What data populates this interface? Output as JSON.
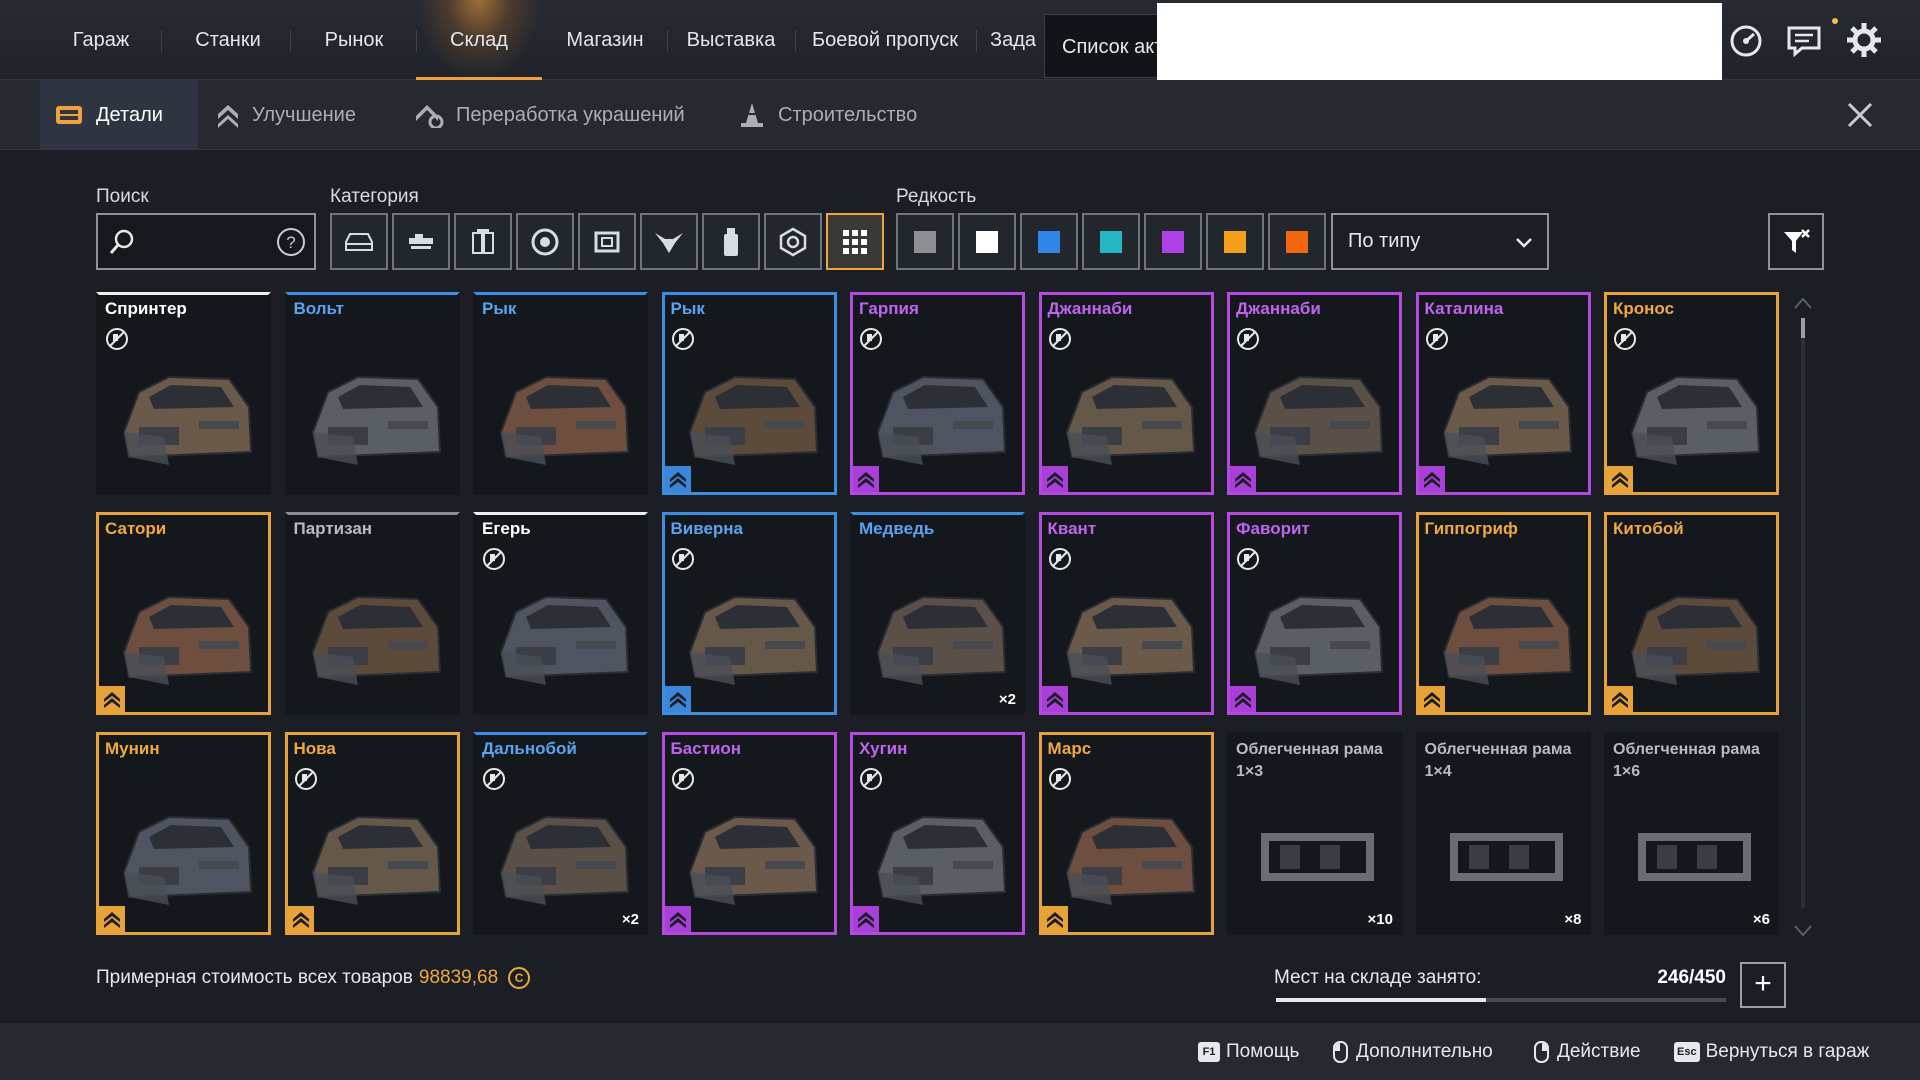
{
  "topnav": {
    "tabs": [
      {
        "label": "Гараж",
        "active": false
      },
      {
        "label": "Станки",
        "active": false
      },
      {
        "label": "Рынок",
        "active": false
      },
      {
        "label": "Склад",
        "active": true
      },
      {
        "label": "Магазин",
        "active": false
      },
      {
        "label": "Выставка",
        "active": false
      },
      {
        "label": "Боевой пропуск",
        "active": false
      },
      {
        "label": "Зада",
        "active": false
      }
    ],
    "tooltip": "Список акт",
    "icons": [
      "speedometer-icon",
      "chat-icon",
      "settings-icon"
    ]
  },
  "subnav": {
    "tabs": [
      {
        "label": "Детали",
        "icon": "parts-icon",
        "active": true
      },
      {
        "label": "Улучшение",
        "icon": "upgrade-icon",
        "active": false
      },
      {
        "label": "Переработка украшений",
        "icon": "recycle-icon",
        "active": false
      },
      {
        "label": "Строительство",
        "icon": "build-icon",
        "active": false
      }
    ],
    "close_icon": "close-icon"
  },
  "filters": {
    "search_label": "Поиск",
    "search_value": "",
    "category_label": "Категория",
    "categories": [
      "cabin-icon",
      "weapon-icon",
      "module-icon",
      "wheel-icon",
      "frame-icon",
      "drone-icon",
      "paint-icon",
      "decor-icon",
      "all-icon"
    ],
    "active_category": 8,
    "rarity_label": "Редкость",
    "rarities": [
      "#8d8f92",
      "#ffffff",
      "#2f86e8",
      "#25b8c4",
      "#b03fe8",
      "#f59f1e",
      "#f2660e"
    ],
    "sort_value": "По типу"
  },
  "items": [
    {
      "name": "Спринтер",
      "rarity": "common",
      "paint": true,
      "upgrade": false,
      "qty": ""
    },
    {
      "name": "Вольт",
      "rarity": "uncommon",
      "paint": false,
      "upgrade": false,
      "qty": ""
    },
    {
      "name": "Рык",
      "rarity": "uncommon",
      "paint": false,
      "upgrade": false,
      "qty": ""
    },
    {
      "name": "Рык",
      "rarity": "uncommon full",
      "paint": true,
      "upgrade": true,
      "qty": ""
    },
    {
      "name": "Гарпия",
      "rarity": "epic",
      "paint": true,
      "upgrade": true,
      "qty": ""
    },
    {
      "name": "Джаннаби",
      "rarity": "epic",
      "paint": true,
      "upgrade": true,
      "qty": ""
    },
    {
      "name": "Джаннаби",
      "rarity": "epic",
      "paint": true,
      "upgrade": true,
      "qty": ""
    },
    {
      "name": "Каталина",
      "rarity": "epic",
      "paint": true,
      "upgrade": true,
      "qty": ""
    },
    {
      "name": "Кронос",
      "rarity": "legendary",
      "paint": true,
      "upgrade": true,
      "qty": ""
    },
    {
      "name": "Сатори",
      "rarity": "legendary",
      "paint": false,
      "upgrade": true,
      "qty": ""
    },
    {
      "name": "Партизан",
      "rarity": "basic",
      "paint": false,
      "upgrade": false,
      "qty": ""
    },
    {
      "name": "Егерь",
      "rarity": "common",
      "paint": true,
      "upgrade": false,
      "qty": ""
    },
    {
      "name": "Виверна",
      "rarity": "uncommon full",
      "paint": true,
      "upgrade": true,
      "qty": ""
    },
    {
      "name": "Медведь",
      "rarity": "uncommon",
      "paint": false,
      "upgrade": false,
      "qty": "×2"
    },
    {
      "name": "Квант",
      "rarity": "epic",
      "paint": true,
      "upgrade": true,
      "qty": ""
    },
    {
      "name": "Фаворит",
      "rarity": "epic",
      "paint": true,
      "upgrade": true,
      "qty": ""
    },
    {
      "name": "Гиппогриф",
      "rarity": "legendary",
      "paint": false,
      "upgrade": true,
      "qty": ""
    },
    {
      "name": "Китобой",
      "rarity": "legendary",
      "paint": false,
      "upgrade": true,
      "qty": ""
    },
    {
      "name": "Мунин",
      "rarity": "legendary",
      "paint": false,
      "upgrade": true,
      "qty": ""
    },
    {
      "name": "Нова",
      "rarity": "legendary",
      "paint": true,
      "upgrade": true,
      "qty": ""
    },
    {
      "name": "Дальнобой",
      "rarity": "uncommon",
      "paint": true,
      "upgrade": false,
      "qty": "×2"
    },
    {
      "name": "Бастион",
      "rarity": "epic",
      "paint": true,
      "upgrade": true,
      "qty": ""
    },
    {
      "name": "Хугин",
      "rarity": "epic",
      "paint": true,
      "upgrade": true,
      "qty": ""
    },
    {
      "name": "Марс",
      "rarity": "legendary",
      "paint": true,
      "upgrade": true,
      "qty": ""
    },
    {
      "name": "Облегченная рама 1×3",
      "rarity": "frame",
      "paint": false,
      "upgrade": false,
      "qty": "×10"
    },
    {
      "name": "Облегченная рама 1×4",
      "rarity": "frame",
      "paint": false,
      "upgrade": false,
      "qty": "×8"
    },
    {
      "name": "Облегченная рама 1×6",
      "rarity": "frame",
      "paint": false,
      "upgrade": false,
      "qty": "×6"
    }
  ],
  "bottom": {
    "value_label": "Примерная стоимость всех товаров",
    "value_amount": "98839,68",
    "storage_label": "Мест на складе занято:",
    "storage_count": "246/450",
    "storage_fraction": 0.4667
  },
  "footer": [
    {
      "key": "F1",
      "label": "Помощь"
    },
    {
      "mouse": "l",
      "label": "Дополнительно"
    },
    {
      "mouse": "r",
      "label": "Действие"
    },
    {
      "key": "Esc",
      "label": "Вернуться в гараж"
    }
  ]
}
